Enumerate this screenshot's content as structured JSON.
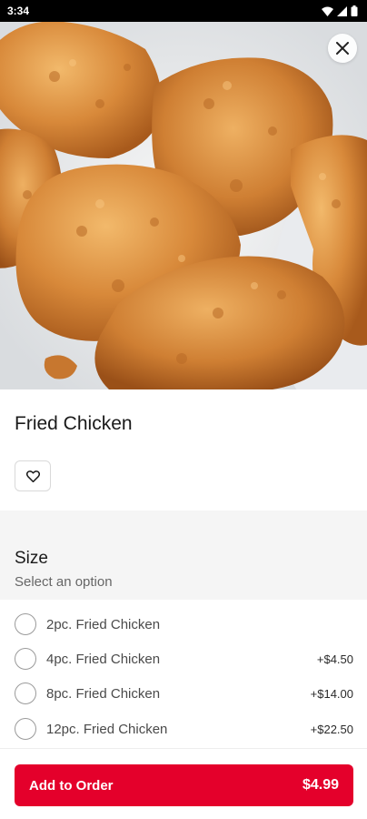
{
  "status_bar": {
    "time": "3:34"
  },
  "hero": {
    "image_icon": "fried-chicken-photo"
  },
  "product": {
    "title": "Fried Chicken"
  },
  "size": {
    "title": "Size",
    "subtitle": "Select an option",
    "options": [
      {
        "label": "2pc. Fried Chicken",
        "price": ""
      },
      {
        "label": "4pc. Fried Chicken",
        "price": "+$4.50"
      },
      {
        "label": "8pc. Fried Chicken",
        "price": "+$14.00"
      },
      {
        "label": "12pc. Fried Chicken",
        "price": "+$22.50"
      }
    ]
  },
  "footer": {
    "button_label": "Add to Order",
    "price": "$4.99"
  },
  "colors": {
    "accent": "#e4002b",
    "section_bg": "#f5f5f5"
  }
}
